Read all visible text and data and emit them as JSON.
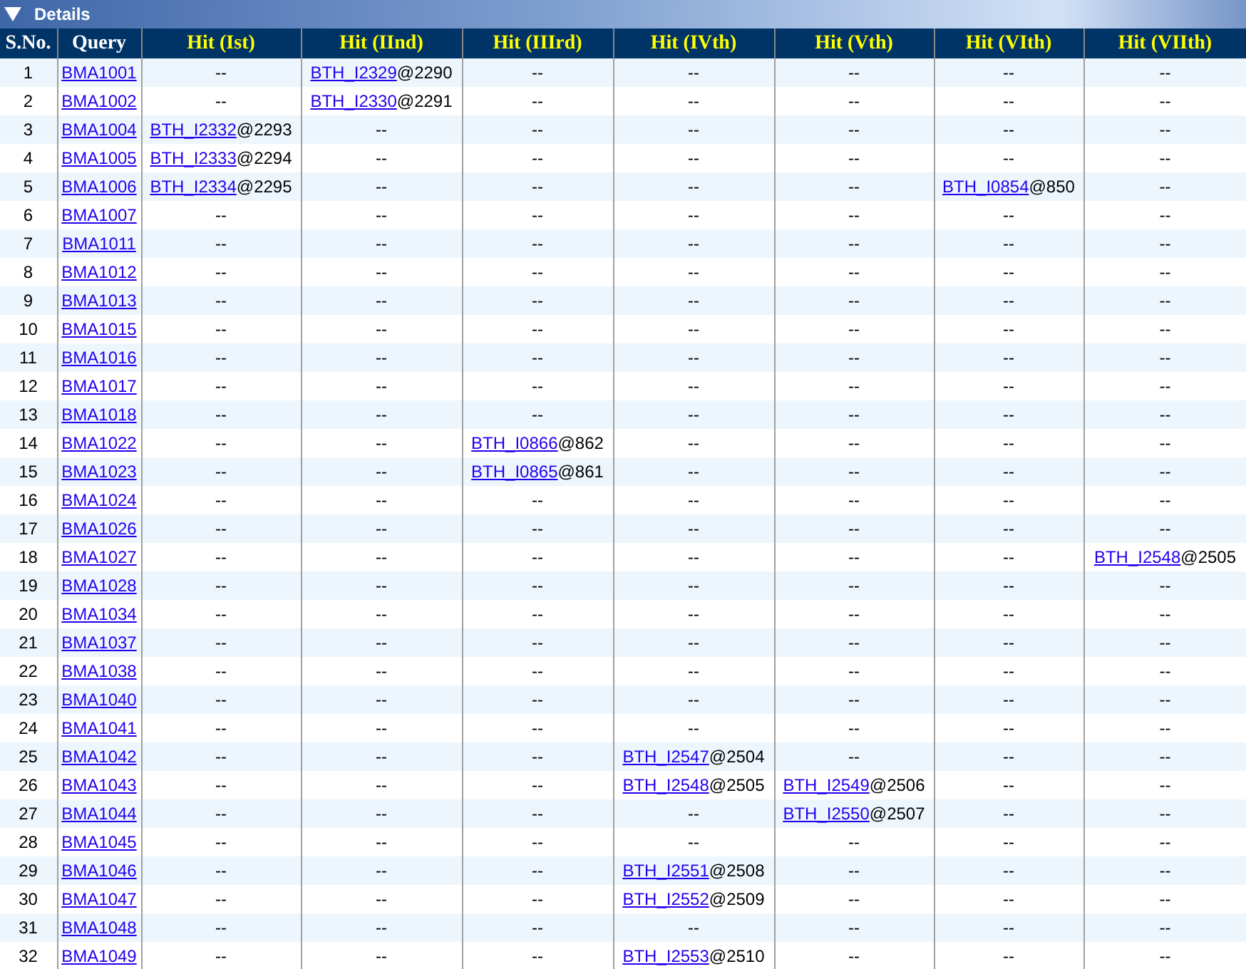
{
  "panel": {
    "title": "Details",
    "expanded": true
  },
  "table": {
    "columns": [
      "S.No.",
      "Query",
      "Hit (Ist)",
      "Hit (IInd)",
      "Hit (IIIrd)",
      "Hit (IVth)",
      "Hit (Vth)",
      "Hit (VIth)",
      "Hit (VIIth)"
    ],
    "rows": [
      {
        "no": "1",
        "query": "BMA1001",
        "hits": [
          "--",
          {
            "id": "BTH_I2329",
            "at": "@2290"
          },
          "--",
          "--",
          "--",
          "--",
          "--"
        ]
      },
      {
        "no": "2",
        "query": "BMA1002",
        "hits": [
          "--",
          {
            "id": "BTH_I2330",
            "at": "@2291"
          },
          "--",
          "--",
          "--",
          "--",
          "--"
        ]
      },
      {
        "no": "3",
        "query": "BMA1004",
        "hits": [
          {
            "id": "BTH_I2332",
            "at": "@2293"
          },
          "--",
          "--",
          "--",
          "--",
          "--",
          "--"
        ]
      },
      {
        "no": "4",
        "query": "BMA1005",
        "hits": [
          {
            "id": "BTH_I2333",
            "at": "@2294"
          },
          "--",
          "--",
          "--",
          "--",
          "--",
          "--"
        ]
      },
      {
        "no": "5",
        "query": "BMA1006",
        "hits": [
          {
            "id": "BTH_I2334",
            "at": "@2295"
          },
          "--",
          "--",
          "--",
          "--",
          {
            "id": "BTH_I0854",
            "at": "@850"
          },
          "--"
        ]
      },
      {
        "no": "6",
        "query": "BMA1007",
        "hits": [
          "--",
          "--",
          "--",
          "--",
          "--",
          "--",
          "--"
        ]
      },
      {
        "no": "7",
        "query": "BMA1011",
        "hits": [
          "--",
          "--",
          "--",
          "--",
          "--",
          "--",
          "--"
        ]
      },
      {
        "no": "8",
        "query": "BMA1012",
        "hits": [
          "--",
          "--",
          "--",
          "--",
          "--",
          "--",
          "--"
        ]
      },
      {
        "no": "9",
        "query": "BMA1013",
        "hits": [
          "--",
          "--",
          "--",
          "--",
          "--",
          "--",
          "--"
        ]
      },
      {
        "no": "10",
        "query": "BMA1015",
        "hits": [
          "--",
          "--",
          "--",
          "--",
          "--",
          "--",
          "--"
        ]
      },
      {
        "no": "11",
        "query": "BMA1016",
        "hits": [
          "--",
          "--",
          "--",
          "--",
          "--",
          "--",
          "--"
        ]
      },
      {
        "no": "12",
        "query": "BMA1017",
        "hits": [
          "--",
          "--",
          "--",
          "--",
          "--",
          "--",
          "--"
        ]
      },
      {
        "no": "13",
        "query": "BMA1018",
        "hits": [
          "--",
          "--",
          "--",
          "--",
          "--",
          "--",
          "--"
        ]
      },
      {
        "no": "14",
        "query": "BMA1022",
        "hits": [
          "--",
          "--",
          {
            "id": "BTH_I0866",
            "at": "@862"
          },
          "--",
          "--",
          "--",
          "--"
        ]
      },
      {
        "no": "15",
        "query": "BMA1023",
        "hits": [
          "--",
          "--",
          {
            "id": "BTH_I0865",
            "at": "@861"
          },
          "--",
          "--",
          "--",
          "--"
        ]
      },
      {
        "no": "16",
        "query": "BMA1024",
        "hits": [
          "--",
          "--",
          "--",
          "--",
          "--",
          "--",
          "--"
        ]
      },
      {
        "no": "17",
        "query": "BMA1026",
        "hits": [
          "--",
          "--",
          "--",
          "--",
          "--",
          "--",
          "--"
        ]
      },
      {
        "no": "18",
        "query": "BMA1027",
        "hits": [
          "--",
          "--",
          "--",
          "--",
          "--",
          "--",
          {
            "id": "BTH_I2548",
            "at": "@2505"
          }
        ]
      },
      {
        "no": "19",
        "query": "BMA1028",
        "hits": [
          "--",
          "--",
          "--",
          "--",
          "--",
          "--",
          "--"
        ]
      },
      {
        "no": "20",
        "query": "BMA1034",
        "hits": [
          "--",
          "--",
          "--",
          "--",
          "--",
          "--",
          "--"
        ]
      },
      {
        "no": "21",
        "query": "BMA1037",
        "hits": [
          "--",
          "--",
          "--",
          "--",
          "--",
          "--",
          "--"
        ]
      },
      {
        "no": "22",
        "query": "BMA1038",
        "hits": [
          "--",
          "--",
          "--",
          "--",
          "--",
          "--",
          "--"
        ]
      },
      {
        "no": "23",
        "query": "BMA1040",
        "hits": [
          "--",
          "--",
          "--",
          "--",
          "--",
          "--",
          "--"
        ]
      },
      {
        "no": "24",
        "query": "BMA1041",
        "hits": [
          "--",
          "--",
          "--",
          "--",
          "--",
          "--",
          "--"
        ]
      },
      {
        "no": "25",
        "query": "BMA1042",
        "hits": [
          "--",
          "--",
          "--",
          {
            "id": "BTH_I2547",
            "at": "@2504"
          },
          "--",
          "--",
          "--"
        ]
      },
      {
        "no": "26",
        "query": "BMA1043",
        "hits": [
          "--",
          "--",
          "--",
          {
            "id": "BTH_I2548",
            "at": "@2505"
          },
          {
            "id": "BTH_I2549",
            "at": "@2506"
          },
          "--",
          "--"
        ]
      },
      {
        "no": "27",
        "query": "BMA1044",
        "hits": [
          "--",
          "--",
          "--",
          "--",
          {
            "id": "BTH_I2550",
            "at": "@2507"
          },
          "--",
          "--"
        ]
      },
      {
        "no": "28",
        "query": "BMA1045",
        "hits": [
          "--",
          "--",
          "--",
          "--",
          "--",
          "--",
          "--"
        ]
      },
      {
        "no": "29",
        "query": "BMA1046",
        "hits": [
          "--",
          "--",
          "--",
          {
            "id": "BTH_I2551",
            "at": "@2508"
          },
          "--",
          "--",
          "--"
        ]
      },
      {
        "no": "30",
        "query": "BMA1047",
        "hits": [
          "--",
          "--",
          "--",
          {
            "id": "BTH_I2552",
            "at": "@2509"
          },
          "--",
          "--",
          "--"
        ]
      },
      {
        "no": "31",
        "query": "BMA1048",
        "hits": [
          "--",
          "--",
          "--",
          "--",
          "--",
          "--",
          "--"
        ]
      },
      {
        "no": "32",
        "query": "BMA1049",
        "hits": [
          "--",
          "--",
          "--",
          {
            "id": "BTH_I2553",
            "at": "@2510"
          },
          "--",
          "--",
          "--"
        ]
      }
    ]
  }
}
